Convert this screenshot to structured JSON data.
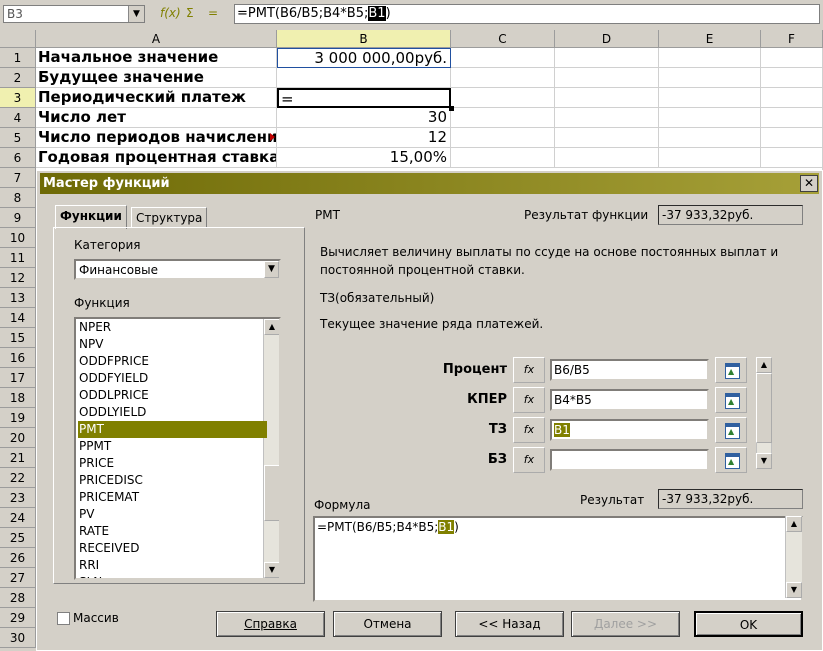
{
  "formula_bar": {
    "name_box": "B3",
    "formula": "=PMT(B6/B5;B4*B5;",
    "formula_highlight": "B1",
    "formula_end": ")"
  },
  "sheet": {
    "columns": [
      "A",
      "B",
      "C",
      "D",
      "E",
      "F"
    ],
    "rows": [
      {
        "num": "1",
        "a": "Начальное значение",
        "b": "3 000 000,00руб."
      },
      {
        "num": "2",
        "a": "Будущее значение",
        "b": ""
      },
      {
        "num": "3",
        "a": "Периодический платеж",
        "b": "="
      },
      {
        "num": "4",
        "a": "Число лет",
        "b": "30"
      },
      {
        "num": "5",
        "a": "Число периодов начислени",
        "b": "12"
      },
      {
        "num": "6",
        "a": "Годовая процентная ставка",
        "b": "15,00%"
      },
      {
        "num": "7"
      },
      {
        "num": "8"
      },
      {
        "num": "9"
      },
      {
        "num": "10"
      },
      {
        "num": "11"
      },
      {
        "num": "12"
      },
      {
        "num": "13"
      },
      {
        "num": "14"
      },
      {
        "num": "15"
      },
      {
        "num": "16"
      },
      {
        "num": "17"
      },
      {
        "num": "18"
      },
      {
        "num": "19"
      },
      {
        "num": "20"
      },
      {
        "num": "21"
      },
      {
        "num": "22"
      },
      {
        "num": "23"
      },
      {
        "num": "24"
      },
      {
        "num": "25"
      },
      {
        "num": "26"
      },
      {
        "num": "27"
      },
      {
        "num": "28"
      },
      {
        "num": "29"
      },
      {
        "num": "30"
      }
    ]
  },
  "dialog": {
    "title": "Мастер функций",
    "tabs": [
      "Функции",
      "Структура"
    ],
    "category_label": "Категория",
    "category_value": "Финансовые",
    "function_label": "Функция",
    "functions": [
      "NPER",
      "NPV",
      "ODDFPRICE",
      "ODDFYIELD",
      "ODDLPRICE",
      "ODDLYIELD",
      "PMT",
      "PPMT",
      "PRICE",
      "PRICEDISC",
      "PRICEMAT",
      "PV",
      "RATE",
      "RECEIVED",
      "RRI",
      "SLN"
    ],
    "selected_function": "PMT",
    "array_label": "Массив",
    "func_name": "PMT",
    "func_result_label": "Результат функции",
    "func_result_value": "-37 933,32руб.",
    "description": "Вычисляет величину выплаты по ссуде на основе постоянных выплат и постоянной процентной ставки.",
    "arg_name": "ТЗ(обязательный)",
    "arg_desc": "Текущее значение ряда платежей.",
    "fx_label": "fx",
    "args": [
      {
        "label": "Процент",
        "value": "B6/B5"
      },
      {
        "label": "КПЕР",
        "value": "B4*B5"
      },
      {
        "label": "ТЗ",
        "value": "B1"
      },
      {
        "label": "БЗ",
        "value": ""
      }
    ],
    "formula_label": "Формула",
    "result_label": "Результат",
    "result_value": "-37 933,32руб.",
    "formula_text_start": "=PMT(B6/B5;B4*B5;",
    "formula_text_hl": "B1",
    "formula_text_end": ")",
    "buttons": {
      "help": "Справка",
      "cancel": "Отмена",
      "back": "<< Назад",
      "next": "Далее >>",
      "ok": "OK"
    }
  }
}
